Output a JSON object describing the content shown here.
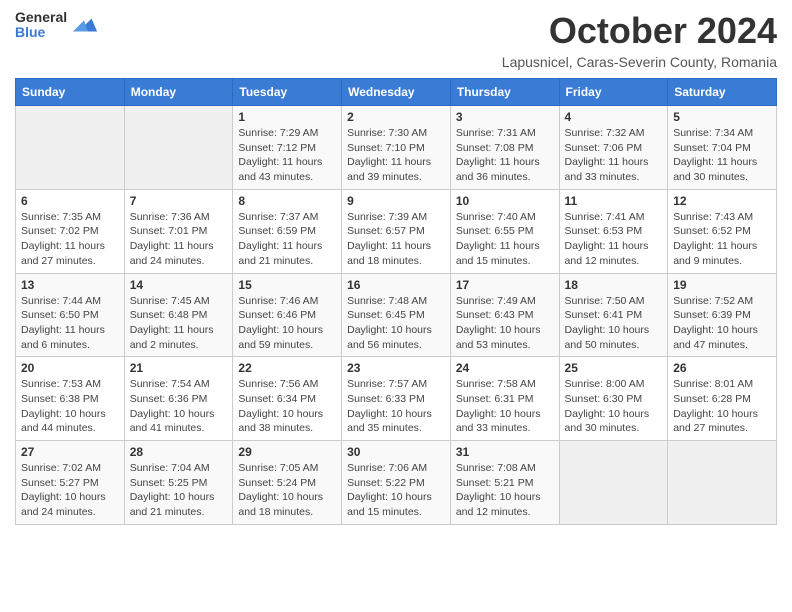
{
  "header": {
    "logo_general": "General",
    "logo_blue": "Blue",
    "month_title": "October 2024",
    "subtitle": "Lapusnicel, Caras-Severin County, Romania"
  },
  "days_of_week": [
    "Sunday",
    "Monday",
    "Tuesday",
    "Wednesday",
    "Thursday",
    "Friday",
    "Saturday"
  ],
  "weeks": [
    [
      {
        "day": "",
        "info": ""
      },
      {
        "day": "",
        "info": ""
      },
      {
        "day": "1",
        "info": "Sunrise: 7:29 AM\nSunset: 7:12 PM\nDaylight: 11 hours and 43 minutes."
      },
      {
        "day": "2",
        "info": "Sunrise: 7:30 AM\nSunset: 7:10 PM\nDaylight: 11 hours and 39 minutes."
      },
      {
        "day": "3",
        "info": "Sunrise: 7:31 AM\nSunset: 7:08 PM\nDaylight: 11 hours and 36 minutes."
      },
      {
        "day": "4",
        "info": "Sunrise: 7:32 AM\nSunset: 7:06 PM\nDaylight: 11 hours and 33 minutes."
      },
      {
        "day": "5",
        "info": "Sunrise: 7:34 AM\nSunset: 7:04 PM\nDaylight: 11 hours and 30 minutes."
      }
    ],
    [
      {
        "day": "6",
        "info": "Sunrise: 7:35 AM\nSunset: 7:02 PM\nDaylight: 11 hours and 27 minutes."
      },
      {
        "day": "7",
        "info": "Sunrise: 7:36 AM\nSunset: 7:01 PM\nDaylight: 11 hours and 24 minutes."
      },
      {
        "day": "8",
        "info": "Sunrise: 7:37 AM\nSunset: 6:59 PM\nDaylight: 11 hours and 21 minutes."
      },
      {
        "day": "9",
        "info": "Sunrise: 7:39 AM\nSunset: 6:57 PM\nDaylight: 11 hours and 18 minutes."
      },
      {
        "day": "10",
        "info": "Sunrise: 7:40 AM\nSunset: 6:55 PM\nDaylight: 11 hours and 15 minutes."
      },
      {
        "day": "11",
        "info": "Sunrise: 7:41 AM\nSunset: 6:53 PM\nDaylight: 11 hours and 12 minutes."
      },
      {
        "day": "12",
        "info": "Sunrise: 7:43 AM\nSunset: 6:52 PM\nDaylight: 11 hours and 9 minutes."
      }
    ],
    [
      {
        "day": "13",
        "info": "Sunrise: 7:44 AM\nSunset: 6:50 PM\nDaylight: 11 hours and 6 minutes."
      },
      {
        "day": "14",
        "info": "Sunrise: 7:45 AM\nSunset: 6:48 PM\nDaylight: 11 hours and 2 minutes."
      },
      {
        "day": "15",
        "info": "Sunrise: 7:46 AM\nSunset: 6:46 PM\nDaylight: 10 hours and 59 minutes."
      },
      {
        "day": "16",
        "info": "Sunrise: 7:48 AM\nSunset: 6:45 PM\nDaylight: 10 hours and 56 minutes."
      },
      {
        "day": "17",
        "info": "Sunrise: 7:49 AM\nSunset: 6:43 PM\nDaylight: 10 hours and 53 minutes."
      },
      {
        "day": "18",
        "info": "Sunrise: 7:50 AM\nSunset: 6:41 PM\nDaylight: 10 hours and 50 minutes."
      },
      {
        "day": "19",
        "info": "Sunrise: 7:52 AM\nSunset: 6:39 PM\nDaylight: 10 hours and 47 minutes."
      }
    ],
    [
      {
        "day": "20",
        "info": "Sunrise: 7:53 AM\nSunset: 6:38 PM\nDaylight: 10 hours and 44 minutes."
      },
      {
        "day": "21",
        "info": "Sunrise: 7:54 AM\nSunset: 6:36 PM\nDaylight: 10 hours and 41 minutes."
      },
      {
        "day": "22",
        "info": "Sunrise: 7:56 AM\nSunset: 6:34 PM\nDaylight: 10 hours and 38 minutes."
      },
      {
        "day": "23",
        "info": "Sunrise: 7:57 AM\nSunset: 6:33 PM\nDaylight: 10 hours and 35 minutes."
      },
      {
        "day": "24",
        "info": "Sunrise: 7:58 AM\nSunset: 6:31 PM\nDaylight: 10 hours and 33 minutes."
      },
      {
        "day": "25",
        "info": "Sunrise: 8:00 AM\nSunset: 6:30 PM\nDaylight: 10 hours and 30 minutes."
      },
      {
        "day": "26",
        "info": "Sunrise: 8:01 AM\nSunset: 6:28 PM\nDaylight: 10 hours and 27 minutes."
      }
    ],
    [
      {
        "day": "27",
        "info": "Sunrise: 7:02 AM\nSunset: 5:27 PM\nDaylight: 10 hours and 24 minutes."
      },
      {
        "day": "28",
        "info": "Sunrise: 7:04 AM\nSunset: 5:25 PM\nDaylight: 10 hours and 21 minutes."
      },
      {
        "day": "29",
        "info": "Sunrise: 7:05 AM\nSunset: 5:24 PM\nDaylight: 10 hours and 18 minutes."
      },
      {
        "day": "30",
        "info": "Sunrise: 7:06 AM\nSunset: 5:22 PM\nDaylight: 10 hours and 15 minutes."
      },
      {
        "day": "31",
        "info": "Sunrise: 7:08 AM\nSunset: 5:21 PM\nDaylight: 10 hours and 12 minutes."
      },
      {
        "day": "",
        "info": ""
      },
      {
        "day": "",
        "info": ""
      }
    ]
  ]
}
